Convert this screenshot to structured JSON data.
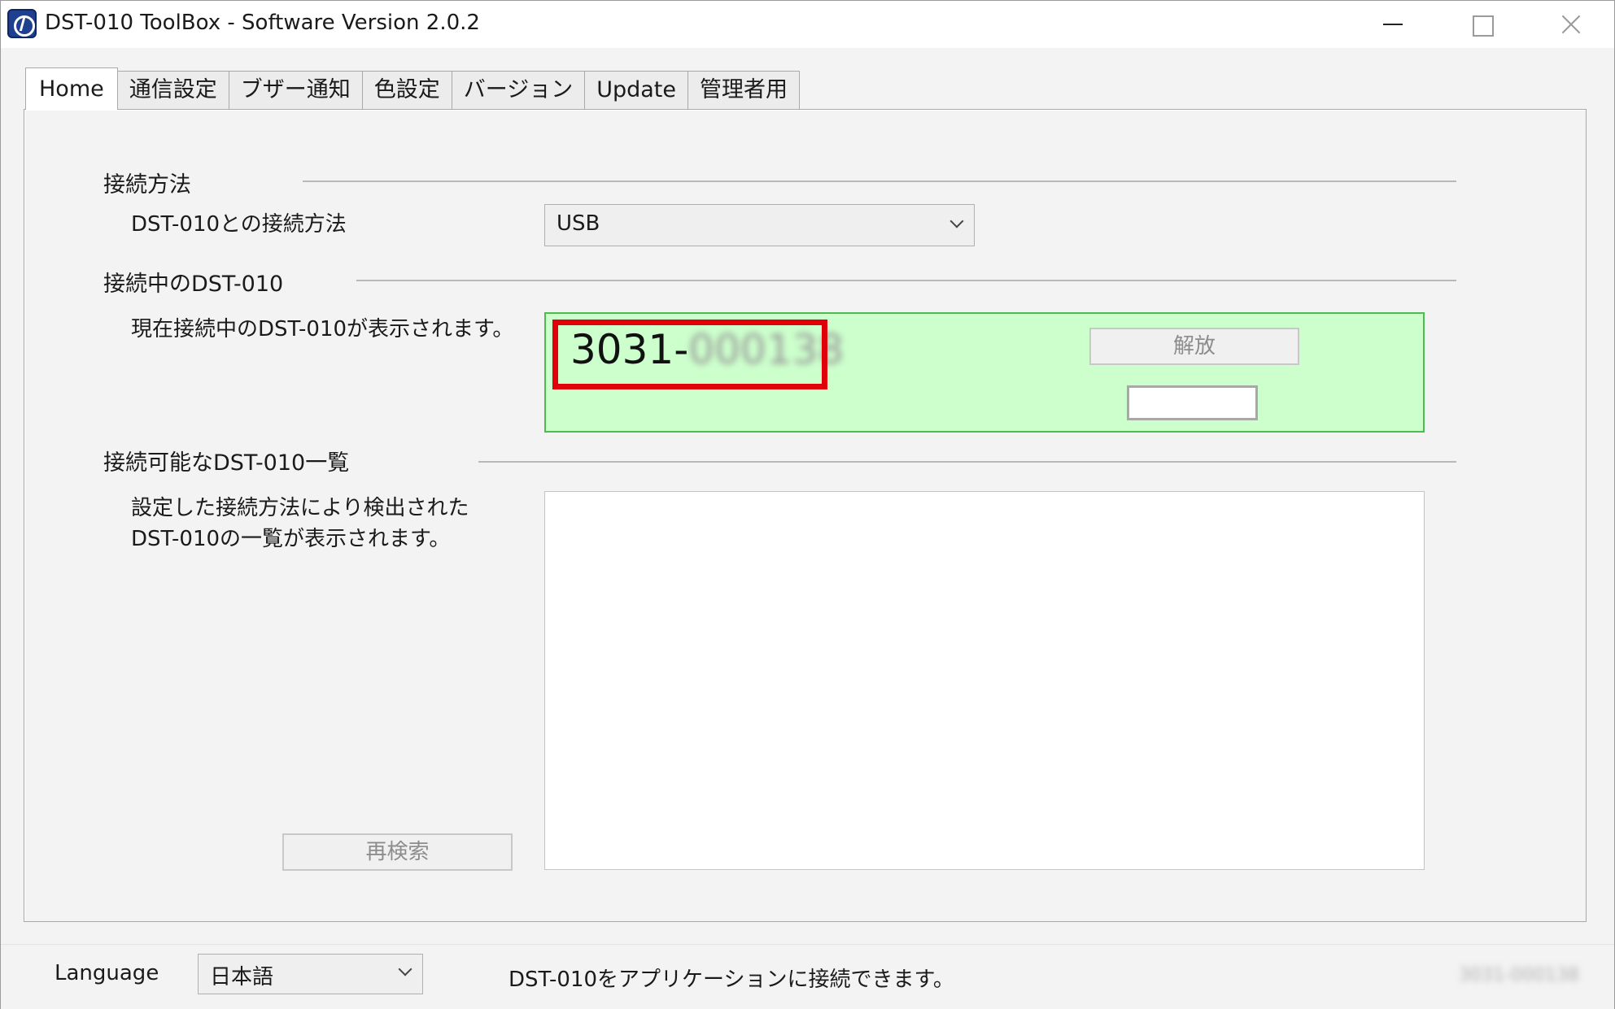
{
  "window": {
    "title": "DST-010 ToolBox - Software Version 2.0.2",
    "app_icon": "dst-app-icon",
    "controls": [
      "minimize-icon",
      "maximize-icon",
      "close-icon"
    ]
  },
  "tabs": [
    {
      "label": "Home",
      "active": true
    },
    {
      "label": "通信設定",
      "active": false
    },
    {
      "label": "ブザー通知",
      "active": false
    },
    {
      "label": "色設定",
      "active": false
    },
    {
      "label": "バージョン",
      "active": false
    },
    {
      "label": "Update",
      "active": false
    },
    {
      "label": "管理者用",
      "active": false
    }
  ],
  "connection_method": {
    "section_title": "接続方法",
    "label": "DST-010との接続方法",
    "selected": "USB"
  },
  "connected_device": {
    "section_title": "接続中のDST-010",
    "description": "現在接続中のDST-010が表示されます。",
    "id_prefix": "3031-",
    "id_suffix_blurred": "000138",
    "release_button": "解放",
    "box_color": "#ccffcc",
    "highlight_color": "#e0000a"
  },
  "available_devices": {
    "section_title": "接続可能なDST-010一覧",
    "description_line1": "設定した接続方法により検出された",
    "description_line2": "DST-010の一覧が表示されます。",
    "rescan_button": "再検索"
  },
  "statusbar": {
    "language_label": "Language",
    "language_selected": "日本語",
    "message": "DST-010をアプリケーションに接続できます。",
    "serial_blurred": "3031-000138"
  }
}
